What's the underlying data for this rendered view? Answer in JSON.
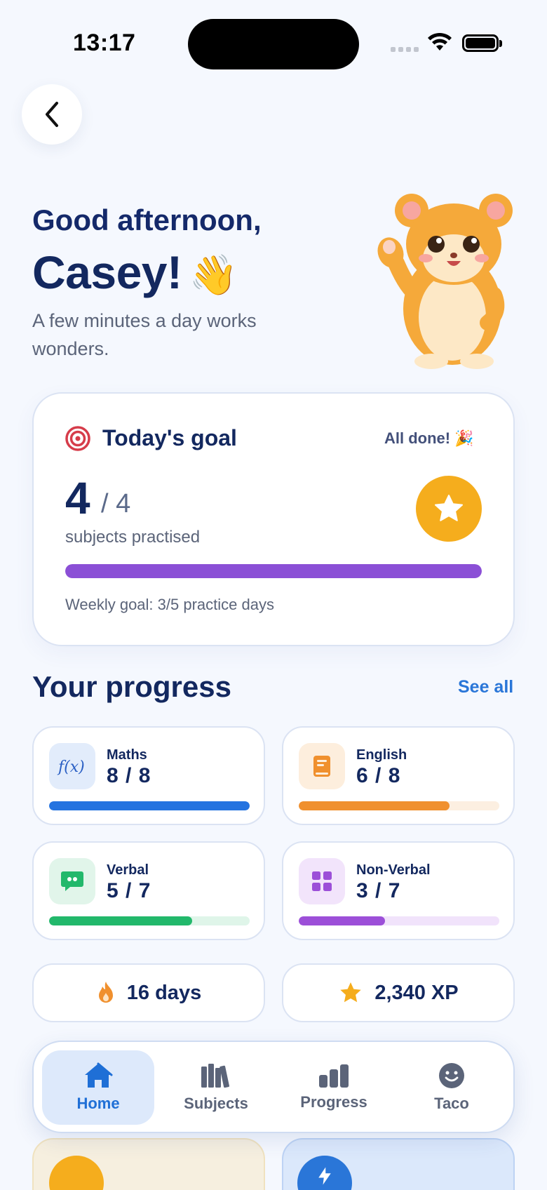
{
  "status_bar": {
    "time": "13:17"
  },
  "greeting": {
    "line1": "Good afternoon,",
    "name": "Casey!",
    "wave_emoji": "👋",
    "subtitle": "A few minutes a day works wonders."
  },
  "goal_card": {
    "title": "Today's goal",
    "status": "All done! 🎉",
    "count": "4",
    "total": "/ 4",
    "caption": "subjects practised",
    "progress": 1.0,
    "weekly": "Weekly goal: 3/5 practice days",
    "icon": "target-icon",
    "badge_icon": "star-icon"
  },
  "progress_section": {
    "title": "Your progress",
    "see_all": "See all",
    "subjects": [
      {
        "name": "Maths",
        "value": "8 / 8",
        "progress": 1.0,
        "color": "#2473e0",
        "track": "#dde8fb",
        "icon_bg": "#e2ecfb",
        "icon": "function-icon"
      },
      {
        "name": "English",
        "value": "6 / 8",
        "progress": 0.75,
        "color": "#f0902e",
        "track": "#fcefe1",
        "icon_bg": "#fdeedd",
        "icon": "book-icon"
      },
      {
        "name": "Verbal",
        "value": "5 / 7",
        "progress": 0.714,
        "color": "#22b86b",
        "track": "#dff5e9",
        "icon_bg": "#e1f5ea",
        "icon": "speech-bubble-icon"
      },
      {
        "name": "Non-Verbal",
        "value": "3 / 7",
        "progress": 0.429,
        "color": "#9c4fd8",
        "track": "#f1e3fb",
        "icon_bg": "#f2e4fb",
        "icon": "shapes-grid-icon"
      }
    ]
  },
  "stats": {
    "streak": "16 days",
    "xp": "2,340 XP"
  },
  "tabbar": {
    "tabs": [
      {
        "label": "Home",
        "icon": "home-icon",
        "active": true
      },
      {
        "label": "Subjects",
        "icon": "books-icon",
        "active": false
      },
      {
        "label": "Progress",
        "icon": "bar-chart-icon",
        "active": false
      },
      {
        "label": "Taco",
        "icon": "smiley-icon",
        "active": false
      }
    ]
  },
  "colors": {
    "accent_blue": "#2a76d8",
    "navy_text": "#13285f",
    "goal_bar": "#8b4fd6",
    "star_gold": "#f5ad1d"
  }
}
